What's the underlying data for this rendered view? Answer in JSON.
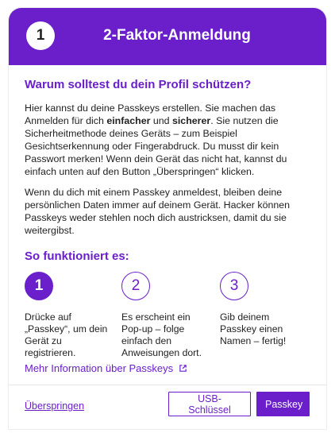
{
  "header": {
    "step_number": "1",
    "title": "2-Faktor-Anmeldung"
  },
  "intro": {
    "heading": "Warum solltest du dein Profil schützen?",
    "paragraph1": {
      "part1": "Hier kannst du deine Passkeys erstellen. Sie machen das Anmelden für dich ",
      "bold1": "einfacher",
      "part2": " und ",
      "bold2": "sicherer",
      "part3": ". Sie nutzen die Sicherheitmethode deines Geräts – zum Beispiel Gesichtserkennung oder Fingerabdruck. Du musst dir kein Passwort merken! Wenn dein Gerät das nicht hat, kannst du einfach unten auf den Button „Überspringen“ klicken."
    },
    "paragraph2": "Wenn du dich mit einem Passkey anmeldest, bleiben deine persönlichen Daten immer auf deinem Gerät. Hacker können Passkeys weder stehlen noch dich austricksen, damit du sie weitergibst."
  },
  "how": {
    "heading": "So funktioniert es:",
    "steps": [
      {
        "number": "1",
        "text": "Drücke auf „Passkey“, um dein Gerät zu registrieren.",
        "active": true
      },
      {
        "number": "2",
        "text": "Es erscheint ein Pop-up – folge einfach den Anweisungen dort.",
        "active": false
      },
      {
        "number": "3",
        "text": "Gib deinem Passkey einen Namen – fertig!",
        "active": false
      }
    ]
  },
  "more_link": {
    "label": "Mehr Information über Passkeys",
    "icon": "external-link-icon"
  },
  "footer": {
    "skip_label": "Überspringen",
    "usb_label": "USB-Schlüssel",
    "passkey_label": "Passkey"
  },
  "colors": {
    "accent": "#6a1fcb",
    "text": "#222222",
    "background": "#ffffff"
  }
}
